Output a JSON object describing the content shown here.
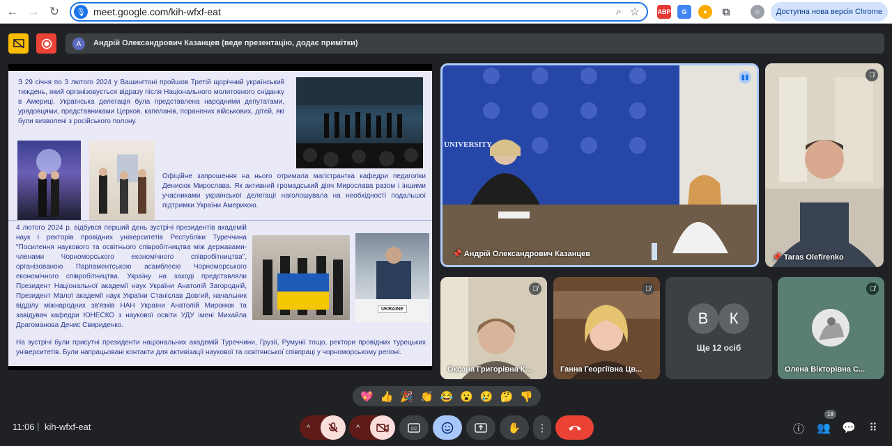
{
  "browser": {
    "url": "meet.google.com/kih-wfxf-eat",
    "update_label": "Доступна нова версія Chrome",
    "ext_abp": "ABP"
  },
  "meet": {
    "presenter_avatar": "A",
    "presenter_text": "Андрій Олександрович Казанцев (веде презентацію, додає примітки)"
  },
  "slide": {
    "para1": "З 29 січня по 3 лютого 2024 у Вашингтоні пройшов Третій щорічний український тиждень, який організовується відразу після Національного молитовного сніданку в Америці. Українська делегація була представлена народними депутатами, урядовцями, представниками Церков, капеланів, поранених військових, дітей, які були визволені з російського полону.",
    "para2": "Офіційне запрошення на нього отримала магістрантка кафедри педагогіки Денисюк Мирослава. Як активний громадський діяч Мирослава разом і іншими учасниками української делегації наголошувала на необхідності подальшої підтримки України Америкою.",
    "para3": "4 лютого 2024 р. відбувся перший день зустрічі президентів академій наук і ректорів провідних університетів Республіки Туреччина \"Посилення наукового та освітнього співробітництва між державами-членами Чорноморського економічного співробітництва\", організованою Парламентською асамблеєю Чорноморського економічного співробітництва. Україну на заході представляли Президент Національної академії наук України Анатолій Загородній, Президент Малої академії наук України Станіслав Довгий, начальник відділу міжнародних зв'язків НАН України Анатолій Миронюк та завідувач кафедри ЮНЕСКО з наукової освіти УДУ імені Михайла Драгоманова Денис Свириденко.",
    "para4": "На зустрічі були присутні президенти національних академій Туреччини, Грузії, Румунії тощо, ректори провідних турецьких університетів. Були напрацьовані контакти для активізації наукової та освітянської співпраці у чорноморському регіоні.",
    "ukraine_sign": "UKRAINE"
  },
  "tiles": {
    "main_name": "Андрій Олександрович Казанцев",
    "university_banner": "UNIVERSITY",
    "taras_name": "Taras Olefirenko",
    "oksana_name": "Оксана Григорівна К...",
    "hanna_name": "Ганна Георгіївна Цв...",
    "more_avatar_1": "В",
    "more_avatar_2": "К",
    "more_label": "Ще 12 осіб",
    "olena_name": "Олена Вікторівна С..."
  },
  "reactions": [
    "💖",
    "👍",
    "🎉",
    "👏",
    "😂",
    "😮",
    "😢",
    "🤔",
    "👎"
  ],
  "bottom": {
    "time": "11:06",
    "separator": "|",
    "meeting_code": "kih-wfxf-eat",
    "participants_count": "18"
  },
  "colors": {
    "accent": "#1a73e8",
    "end_call": "#ea4335",
    "muted_bg": "#f9dedc",
    "slide_text": "#2b3a8f"
  }
}
